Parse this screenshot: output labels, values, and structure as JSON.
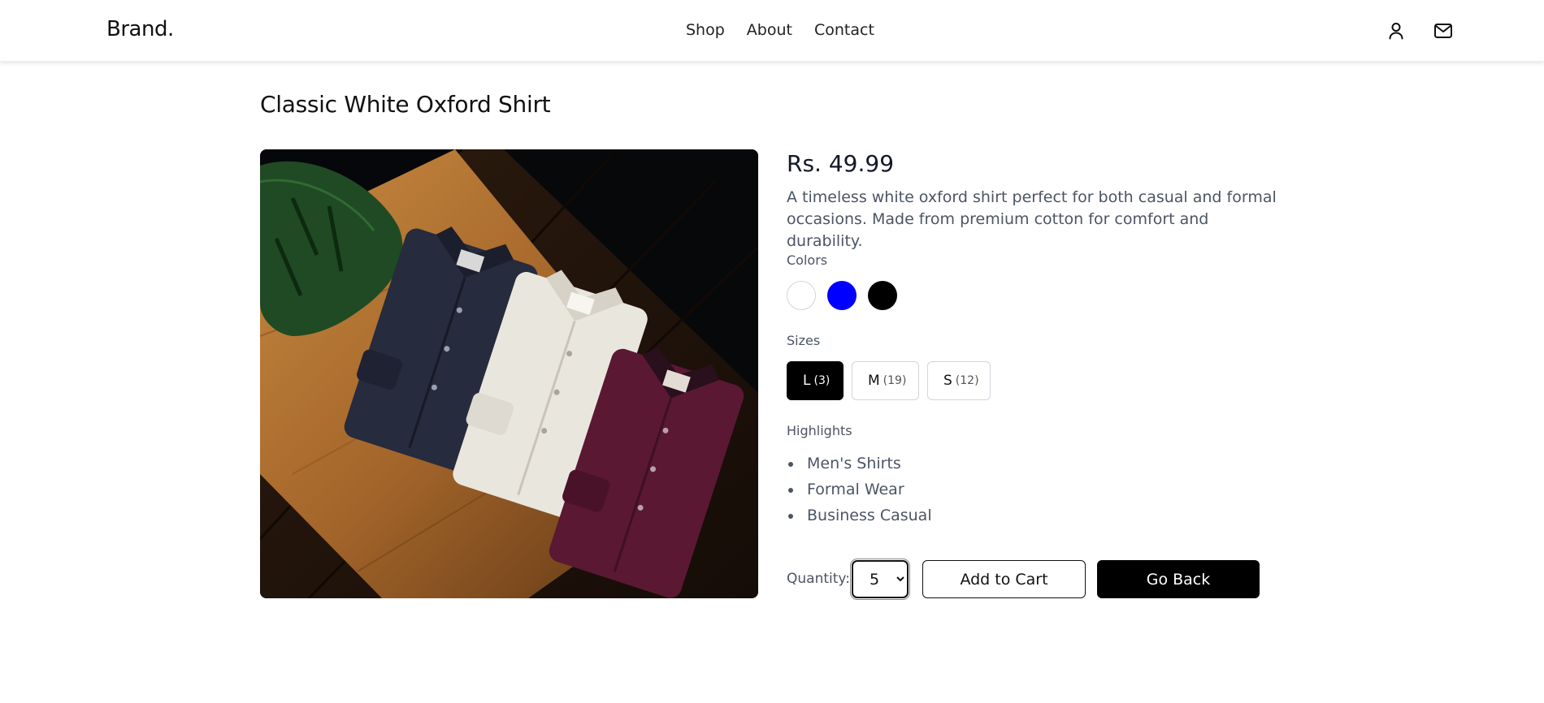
{
  "header": {
    "brand": "Brand.",
    "nav": [
      "Shop",
      "About",
      "Contact"
    ],
    "icons": [
      "user-icon",
      "mail-icon"
    ]
  },
  "product": {
    "title": "Classic White Oxford Shirt",
    "price": "Rs. 49.99",
    "description": "A timeless white oxford shirt perfect for both casual and formal occasions. Made from premium cotton for comfort and durability.",
    "image_alt": "Three folded dress shirts on a wooden table",
    "colors_label": "Colors",
    "colors": [
      {
        "name": "white",
        "hex": "#ffffff"
      },
      {
        "name": "blue",
        "hex": "#0000ff"
      },
      {
        "name": "black",
        "hex": "#000000"
      }
    ],
    "sizes_label": "Sizes",
    "sizes": [
      {
        "label": "L",
        "count": "(3)",
        "selected": true
      },
      {
        "label": "M",
        "count": "(19)",
        "selected": false
      },
      {
        "label": "S",
        "count": "(12)",
        "selected": false
      }
    ],
    "highlights_label": "Highlights",
    "highlights": [
      "Men's Shirts",
      "Formal Wear",
      "Business Casual"
    ],
    "quantity_label": "Quantity:",
    "quantity_value": "5",
    "add_to_cart_label": "Add to Cart",
    "go_back_label": "Go Back"
  },
  "theme": {
    "accent": "#000000",
    "text_muted": "#4b5563",
    "border": "#d1d5db"
  }
}
